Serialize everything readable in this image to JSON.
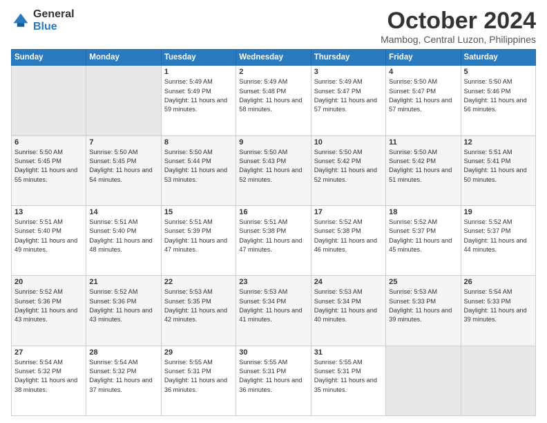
{
  "logo": {
    "general": "General",
    "blue": "Blue"
  },
  "header": {
    "month": "October 2024",
    "location": "Mambog, Central Luzon, Philippines"
  },
  "weekdays": [
    "Sunday",
    "Monday",
    "Tuesday",
    "Wednesday",
    "Thursday",
    "Friday",
    "Saturday"
  ],
  "weeks": [
    [
      {
        "day": "",
        "sunrise": "",
        "sunset": "",
        "daylight": ""
      },
      {
        "day": "",
        "sunrise": "",
        "sunset": "",
        "daylight": ""
      },
      {
        "day": "1",
        "sunrise": "Sunrise: 5:49 AM",
        "sunset": "Sunset: 5:49 PM",
        "daylight": "Daylight: 11 hours and 59 minutes."
      },
      {
        "day": "2",
        "sunrise": "Sunrise: 5:49 AM",
        "sunset": "Sunset: 5:48 PM",
        "daylight": "Daylight: 11 hours and 58 minutes."
      },
      {
        "day": "3",
        "sunrise": "Sunrise: 5:49 AM",
        "sunset": "Sunset: 5:47 PM",
        "daylight": "Daylight: 11 hours and 57 minutes."
      },
      {
        "day": "4",
        "sunrise": "Sunrise: 5:50 AM",
        "sunset": "Sunset: 5:47 PM",
        "daylight": "Daylight: 11 hours and 57 minutes."
      },
      {
        "day": "5",
        "sunrise": "Sunrise: 5:50 AM",
        "sunset": "Sunset: 5:46 PM",
        "daylight": "Daylight: 11 hours and 56 minutes."
      }
    ],
    [
      {
        "day": "6",
        "sunrise": "Sunrise: 5:50 AM",
        "sunset": "Sunset: 5:45 PM",
        "daylight": "Daylight: 11 hours and 55 minutes."
      },
      {
        "day": "7",
        "sunrise": "Sunrise: 5:50 AM",
        "sunset": "Sunset: 5:45 PM",
        "daylight": "Daylight: 11 hours and 54 minutes."
      },
      {
        "day": "8",
        "sunrise": "Sunrise: 5:50 AM",
        "sunset": "Sunset: 5:44 PM",
        "daylight": "Daylight: 11 hours and 53 minutes."
      },
      {
        "day": "9",
        "sunrise": "Sunrise: 5:50 AM",
        "sunset": "Sunset: 5:43 PM",
        "daylight": "Daylight: 11 hours and 52 minutes."
      },
      {
        "day": "10",
        "sunrise": "Sunrise: 5:50 AM",
        "sunset": "Sunset: 5:42 PM",
        "daylight": "Daylight: 11 hours and 52 minutes."
      },
      {
        "day": "11",
        "sunrise": "Sunrise: 5:50 AM",
        "sunset": "Sunset: 5:42 PM",
        "daylight": "Daylight: 11 hours and 51 minutes."
      },
      {
        "day": "12",
        "sunrise": "Sunrise: 5:51 AM",
        "sunset": "Sunset: 5:41 PM",
        "daylight": "Daylight: 11 hours and 50 minutes."
      }
    ],
    [
      {
        "day": "13",
        "sunrise": "Sunrise: 5:51 AM",
        "sunset": "Sunset: 5:40 PM",
        "daylight": "Daylight: 11 hours and 49 minutes."
      },
      {
        "day": "14",
        "sunrise": "Sunrise: 5:51 AM",
        "sunset": "Sunset: 5:40 PM",
        "daylight": "Daylight: 11 hours and 48 minutes."
      },
      {
        "day": "15",
        "sunrise": "Sunrise: 5:51 AM",
        "sunset": "Sunset: 5:39 PM",
        "daylight": "Daylight: 11 hours and 47 minutes."
      },
      {
        "day": "16",
        "sunrise": "Sunrise: 5:51 AM",
        "sunset": "Sunset: 5:38 PM",
        "daylight": "Daylight: 11 hours and 47 minutes."
      },
      {
        "day": "17",
        "sunrise": "Sunrise: 5:52 AM",
        "sunset": "Sunset: 5:38 PM",
        "daylight": "Daylight: 11 hours and 46 minutes."
      },
      {
        "day": "18",
        "sunrise": "Sunrise: 5:52 AM",
        "sunset": "Sunset: 5:37 PM",
        "daylight": "Daylight: 11 hours and 45 minutes."
      },
      {
        "day": "19",
        "sunrise": "Sunrise: 5:52 AM",
        "sunset": "Sunset: 5:37 PM",
        "daylight": "Daylight: 11 hours and 44 minutes."
      }
    ],
    [
      {
        "day": "20",
        "sunrise": "Sunrise: 5:52 AM",
        "sunset": "Sunset: 5:36 PM",
        "daylight": "Daylight: 11 hours and 43 minutes."
      },
      {
        "day": "21",
        "sunrise": "Sunrise: 5:52 AM",
        "sunset": "Sunset: 5:36 PM",
        "daylight": "Daylight: 11 hours and 43 minutes."
      },
      {
        "day": "22",
        "sunrise": "Sunrise: 5:53 AM",
        "sunset": "Sunset: 5:35 PM",
        "daylight": "Daylight: 11 hours and 42 minutes."
      },
      {
        "day": "23",
        "sunrise": "Sunrise: 5:53 AM",
        "sunset": "Sunset: 5:34 PM",
        "daylight": "Daylight: 11 hours and 41 minutes."
      },
      {
        "day": "24",
        "sunrise": "Sunrise: 5:53 AM",
        "sunset": "Sunset: 5:34 PM",
        "daylight": "Daylight: 11 hours and 40 minutes."
      },
      {
        "day": "25",
        "sunrise": "Sunrise: 5:53 AM",
        "sunset": "Sunset: 5:33 PM",
        "daylight": "Daylight: 11 hours and 39 minutes."
      },
      {
        "day": "26",
        "sunrise": "Sunrise: 5:54 AM",
        "sunset": "Sunset: 5:33 PM",
        "daylight": "Daylight: 11 hours and 39 minutes."
      }
    ],
    [
      {
        "day": "27",
        "sunrise": "Sunrise: 5:54 AM",
        "sunset": "Sunset: 5:32 PM",
        "daylight": "Daylight: 11 hours and 38 minutes."
      },
      {
        "day": "28",
        "sunrise": "Sunrise: 5:54 AM",
        "sunset": "Sunset: 5:32 PM",
        "daylight": "Daylight: 11 hours and 37 minutes."
      },
      {
        "day": "29",
        "sunrise": "Sunrise: 5:55 AM",
        "sunset": "Sunset: 5:31 PM",
        "daylight": "Daylight: 11 hours and 36 minutes."
      },
      {
        "day": "30",
        "sunrise": "Sunrise: 5:55 AM",
        "sunset": "Sunset: 5:31 PM",
        "daylight": "Daylight: 11 hours and 36 minutes."
      },
      {
        "day": "31",
        "sunrise": "Sunrise: 5:55 AM",
        "sunset": "Sunset: 5:31 PM",
        "daylight": "Daylight: 11 hours and 35 minutes."
      },
      {
        "day": "",
        "sunrise": "",
        "sunset": "",
        "daylight": ""
      },
      {
        "day": "",
        "sunrise": "",
        "sunset": "",
        "daylight": ""
      }
    ]
  ]
}
